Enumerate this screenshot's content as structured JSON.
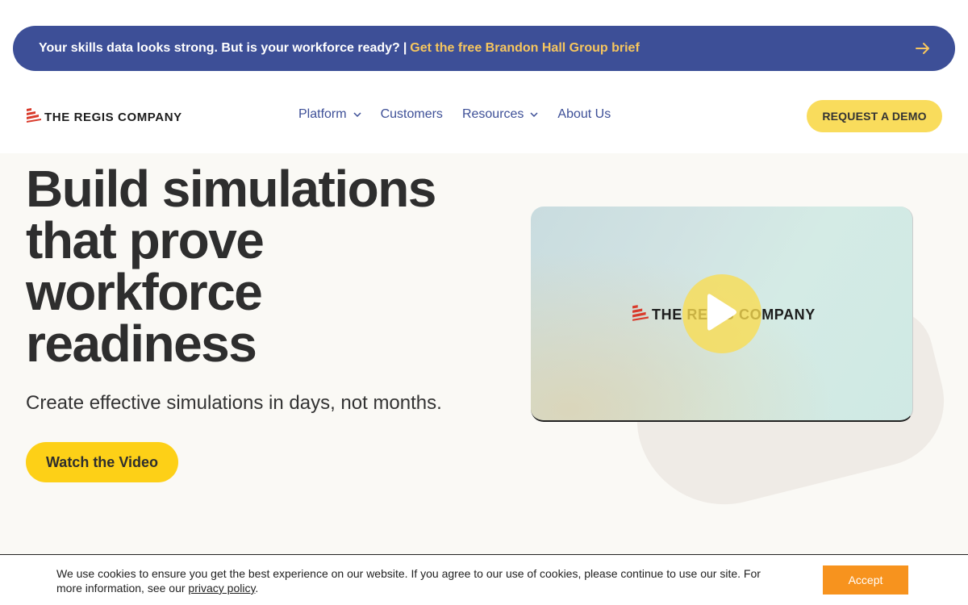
{
  "banner": {
    "lead": "Your skills data looks strong. But is your workforce ready?",
    "separator": "|",
    "link": "Get the free Brandon Hall Group brief",
    "arrow_icon": "arrow-right-icon"
  },
  "header": {
    "logo_text": "THE REGIS COMPANY",
    "nav": [
      {
        "label": "Platform",
        "has_dropdown": true
      },
      {
        "label": "Customers",
        "has_dropdown": false
      },
      {
        "label": "Resources",
        "has_dropdown": true
      },
      {
        "label": "About Us",
        "has_dropdown": false
      }
    ],
    "demo_button": "REQUEST A DEMO"
  },
  "hero": {
    "title_lines": [
      "Build simulations",
      "that prove",
      "workforce",
      "readiness"
    ],
    "subtitle": "Create effective simulations in days, not months.",
    "watch_button": "Watch the Video",
    "video": {
      "logo_text": "THE REGIS COMPANY",
      "play_icon": "play-icon"
    }
  },
  "cookie": {
    "text": "We use cookies to ensure you get the best experience on our website. If you agree to our use of cookies, please continue to use our site. For more information, see our",
    "link": "privacy policy",
    "trailing": ".",
    "accept_button": "Accept"
  },
  "colors": {
    "banner_bg": "#3d4f97",
    "banner_link": "#f6c65e",
    "nav_text": "#3d4f97",
    "demo_button_bg": "#f9dc5c",
    "watch_button_bg": "#fdd017",
    "hero_bg": "#faf9f5",
    "accept_bg": "#f7931e",
    "logo_red": "#d93a2b"
  }
}
